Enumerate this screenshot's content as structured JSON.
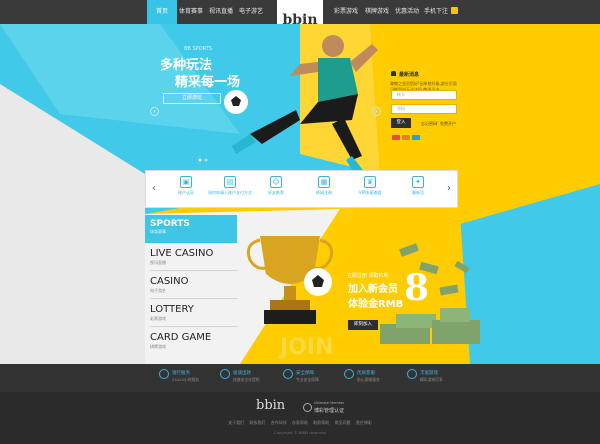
{
  "nav": {
    "items": [
      {
        "label": "首页",
        "active": true
      },
      {
        "label": "体育赛事"
      },
      {
        "label": "视讯直播"
      },
      {
        "label": "电子游艺"
      },
      {
        "label": "彩票游戏"
      },
      {
        "label": "棋牌游戏"
      },
      {
        "label": "优惠活动"
      },
      {
        "label": "手机下注"
      }
    ],
    "logo": "bbin"
  },
  "hero": {
    "tag": "BB SPORTS",
    "title_line1": "多种玩法",
    "title_line2": "精采每一场",
    "button": "立即游玩",
    "prev": "‹",
    "next": "›"
  },
  "panel": {
    "news_title": "最新消息",
    "news_body": "尊敬之会员您好!因系统升级,部分页面可能暂时无法访问,敬请见谅。",
    "account_placeholder": "帐号",
    "password_placeholder": "密码",
    "login": "登入",
    "forgot": "忘记密码",
    "register": "免费开户",
    "links_sep": "/"
  },
  "strip": {
    "items": [
      {
        "label": "账户认证",
        "icon": "id-card-icon",
        "glyph": "▣"
      },
      {
        "label": "如何申请入账户支付方式",
        "icon": "wallet-icon",
        "glyph": "▤"
      },
      {
        "label": "好友推荐",
        "icon": "friends-icon",
        "glyph": "☺"
      },
      {
        "label": "刷网注册",
        "icon": "register-icon",
        "glyph": "▦"
      },
      {
        "label": "VIP快速通道",
        "icon": "vip-icon",
        "glyph": "♛"
      },
      {
        "label": "最新活",
        "icon": "gift-icon",
        "glyph": "✦"
      }
    ],
    "prev": "‹",
    "next": "›"
  },
  "menu": {
    "sports_en": "SPORTS",
    "sports_cn": "体育赛事",
    "items": [
      {
        "en": "LIVE CASINO",
        "cn": "视讯直播"
      },
      {
        "en": "CASINO",
        "cn": "电子游艺"
      },
      {
        "en": "LOTTERY",
        "cn": "彩票游戏"
      },
      {
        "en": "CARD GAME",
        "cn": "棋牌游戏"
      }
    ]
  },
  "promo": {
    "subtitle": "立即注册 领取红利",
    "title_line1": "加入新会员",
    "title_line2": "体验金RMB",
    "big_number": "8",
    "button": "即刻加入",
    "watermark": "JOIN"
  },
  "features": [
    {
      "title": "银行服务",
      "sub": "24x24小时服务",
      "icon": "bank-icon"
    },
    {
      "title": "极速出款",
      "sub": "快速安全存提款",
      "icon": "clock-icon"
    },
    {
      "title": "安全保障",
      "sub": "专业安全保障",
      "icon": "shield-icon"
    },
    {
      "title": "优质客服",
      "sub": "贴心客服服务",
      "icon": "chat-icon"
    },
    {
      "title": "丰富游戏",
      "sub": "精彩游戏尽享",
      "icon": "game-icon"
    }
  ],
  "footer": {
    "logo": "bbin",
    "badge_line1": "Ultimate Member",
    "badge_line2": "博彩管理认证",
    "links": [
      "关于我们",
      "联系我们",
      "合作伙伴",
      "存款帮助",
      "取款帮助",
      "常见问题",
      "责任博彩"
    ],
    "copyright": "Copyright © BBIN reserved"
  },
  "colors": {
    "cyan": "#40c9e8",
    "yellow": "#ffcc00",
    "dark": "#333333"
  }
}
